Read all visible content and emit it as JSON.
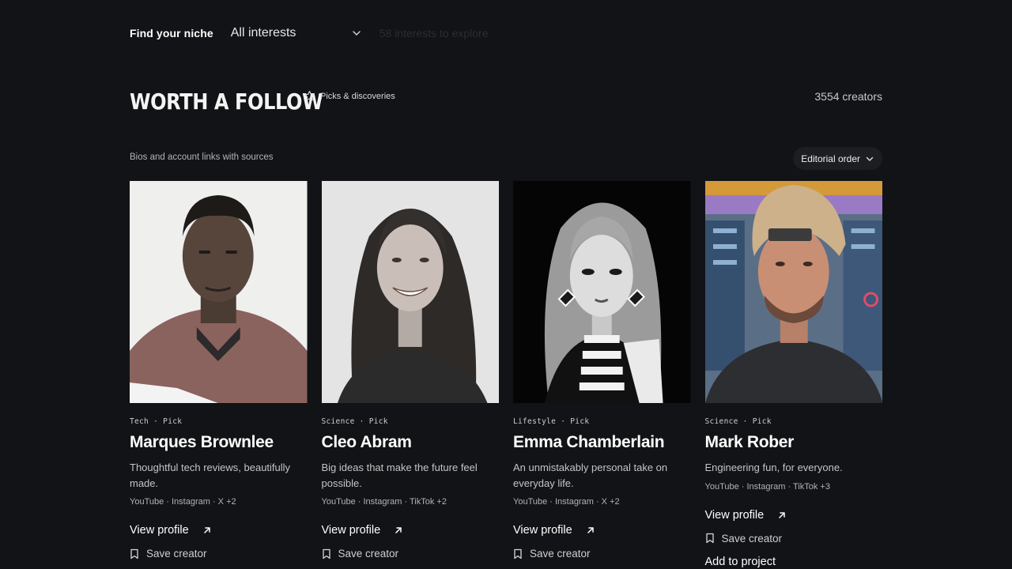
{
  "filter": {
    "label": "Find your niche",
    "selected": "All interests",
    "hint": "58 interests to explore"
  },
  "section": {
    "title": "WORTH A FOLLOW",
    "tag": "Picks & discoveries",
    "count": "3554 creators",
    "subhead": "Bios and account links with sources",
    "sort_label": "Editorial order"
  },
  "cards": [
    {
      "category": "Tech",
      "badge": "Pick",
      "sep": "·",
      "name": "Marques Brownlee",
      "description": "Thoughtful tech reviews, beautifully made.",
      "links": "YouTube · Instagram · X +2",
      "view_label": "View profile",
      "save_label": "Save creator"
    },
    {
      "category": "Science",
      "badge": "Pick",
      "sep": "·",
      "name": "Cleo Abram",
      "description": "Big ideas that make the future feel possible.",
      "links": "YouTube · Instagram · TikTok +2",
      "view_label": "View profile",
      "save_label": "Save creator"
    },
    {
      "category": "Lifestyle",
      "badge": "Pick",
      "sep": "·",
      "name": "Emma Chamberlain",
      "description": "An unmistakably personal take on everyday life.",
      "links": "YouTube · Instagram · X +2",
      "view_label": "View profile",
      "save_label": "Save creator"
    },
    {
      "category": "Science",
      "badge": "Pick",
      "sep": "·",
      "name": "Mark Rober",
      "description": "Engineering fun, for everyone.",
      "links": "YouTube · Instagram · TikTok +3",
      "view_label": "View profile",
      "save_label": "Save creator",
      "extra_label": "Add to project"
    }
  ],
  "icons": {
    "filter_chevron": "chevron-down-icon",
    "tag": "star-icon",
    "sort_chevron": "chevron-down-icon",
    "view": "arrow-up-right-icon",
    "save": "bookmark-icon"
  },
  "colors": {
    "background": "#121316",
    "text": "#ffffff",
    "muted": "#b4b4b4",
    "sort_bg": "#1c1e22"
  }
}
